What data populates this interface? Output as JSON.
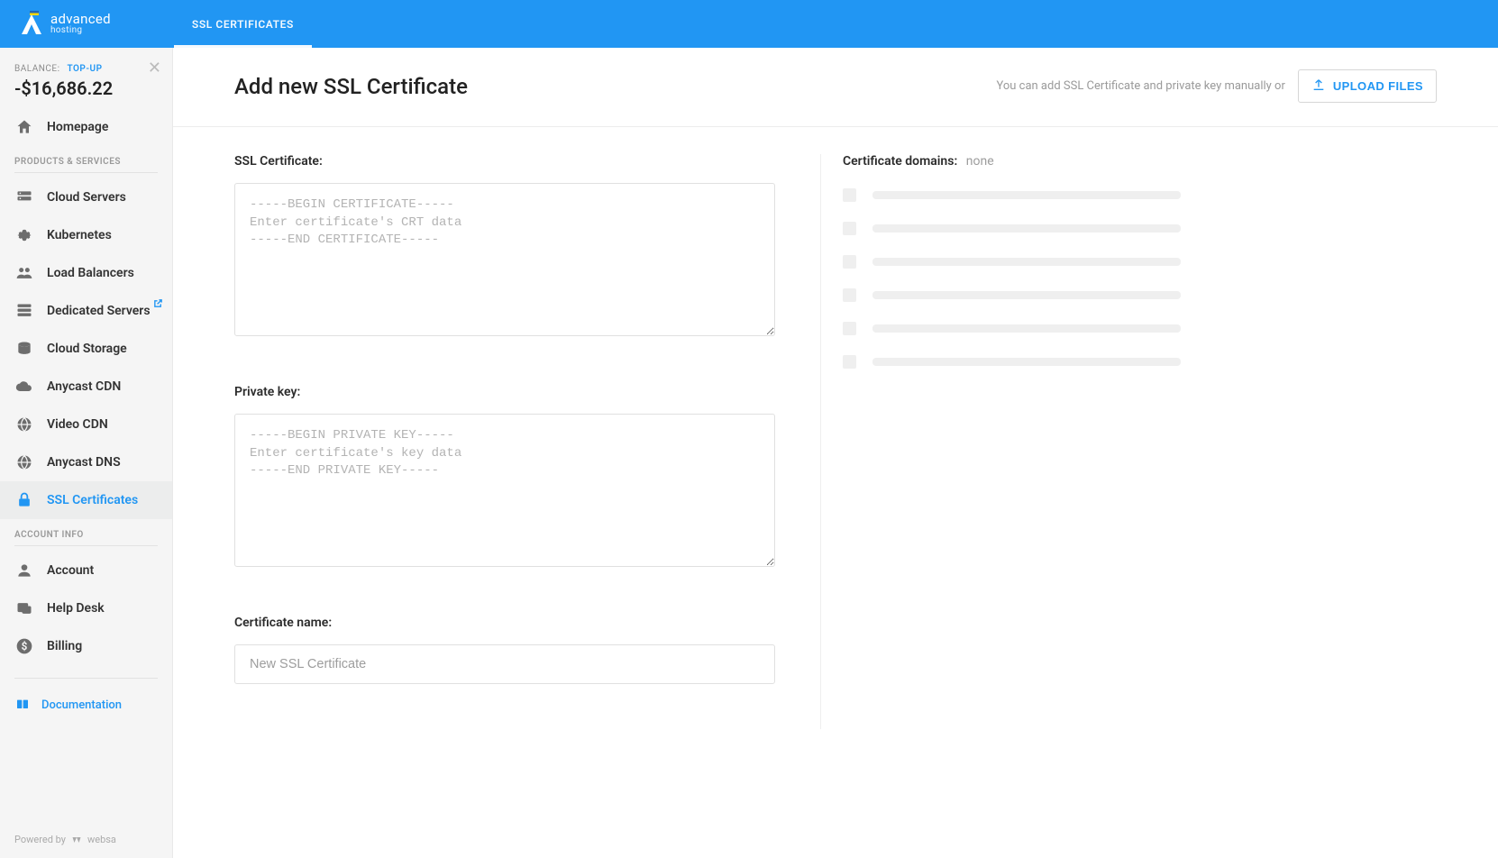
{
  "brand": {
    "name": "advanced",
    "sub": "hosting"
  },
  "tabs": [
    {
      "label": "SSL CERTIFICATES",
      "active": true
    }
  ],
  "sidebar": {
    "balance_label": "BALANCE:",
    "topup": "TOP-UP",
    "balance_value": "-$16,686.22",
    "homepage": "Homepage",
    "products_header": "PRODUCTS & SERVICES",
    "account_header": "ACCOUNT INFO",
    "items": [
      {
        "label": "Cloud Servers",
        "icon": "servers"
      },
      {
        "label": "Kubernetes",
        "icon": "gear"
      },
      {
        "label": "Load Balancers",
        "icon": "users"
      },
      {
        "label": "Dedicated Servers",
        "icon": "rack",
        "external": true
      },
      {
        "label": "Cloud Storage",
        "icon": "cloud-db"
      },
      {
        "label": "Anycast CDN",
        "icon": "cloud"
      },
      {
        "label": "Video CDN",
        "icon": "globe"
      },
      {
        "label": "Anycast DNS",
        "icon": "globe"
      },
      {
        "label": "SSL Certificates",
        "icon": "lock",
        "active": true
      }
    ],
    "account_items": [
      {
        "label": "Account",
        "icon": "person"
      },
      {
        "label": "Help Desk",
        "icon": "helpdesk"
      },
      {
        "label": "Billing",
        "icon": "dollar"
      }
    ],
    "documentation": "Documentation",
    "powered_by": "Powered by",
    "powered_brand": "websa"
  },
  "page": {
    "title": "Add new SSL Certificate",
    "description": "You can add SSL Certificate and private key manually or",
    "upload_button": "UPLOAD FILES",
    "cert_label": "SSL Certificate:",
    "cert_placeholder": "-----BEGIN CERTIFICATE-----\nEnter certificate's CRT data\n-----END CERTIFICATE-----",
    "key_label": "Private key:",
    "key_placeholder": "-----BEGIN PRIVATE KEY-----\nEnter certificate's key data\n-----END PRIVATE KEY-----",
    "name_label": "Certificate name:",
    "name_placeholder": "New SSL Certificate",
    "domains_label": "Certificate domains:",
    "domains_value": "none"
  }
}
